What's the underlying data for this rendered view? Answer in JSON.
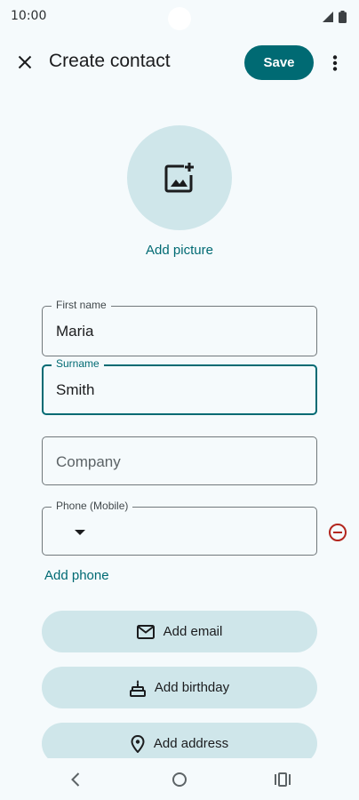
{
  "status_bar": {
    "time": "10:00"
  },
  "app_bar": {
    "title": "Create contact",
    "save_label": "Save"
  },
  "photo": {
    "add_picture_label": "Add picture"
  },
  "form": {
    "first_name": {
      "label": "First name",
      "value": "Maria"
    },
    "surname": {
      "label": "Surname",
      "value": "Smith"
    },
    "company": {
      "placeholder": "Company"
    },
    "phone": {
      "label": "Phone (Mobile)",
      "value": ""
    }
  },
  "actions": {
    "add_phone": "Add phone",
    "add_email": "Add email",
    "add_birthday": "Add birthday",
    "add_address": "Add address"
  },
  "icons": {
    "close": "close-icon",
    "more": "more-vert-icon",
    "add_photo": "add-photo-icon",
    "dropdown": "arrow-drop-down-icon",
    "remove": "remove-circle-icon",
    "email": "mail-icon",
    "birthday": "cake-icon",
    "address": "location-pin-icon"
  },
  "colors": {
    "accent": "#006a73",
    "tonal": "#cfe6ea",
    "background": "#f5fafc",
    "remove": "#b3261e"
  }
}
